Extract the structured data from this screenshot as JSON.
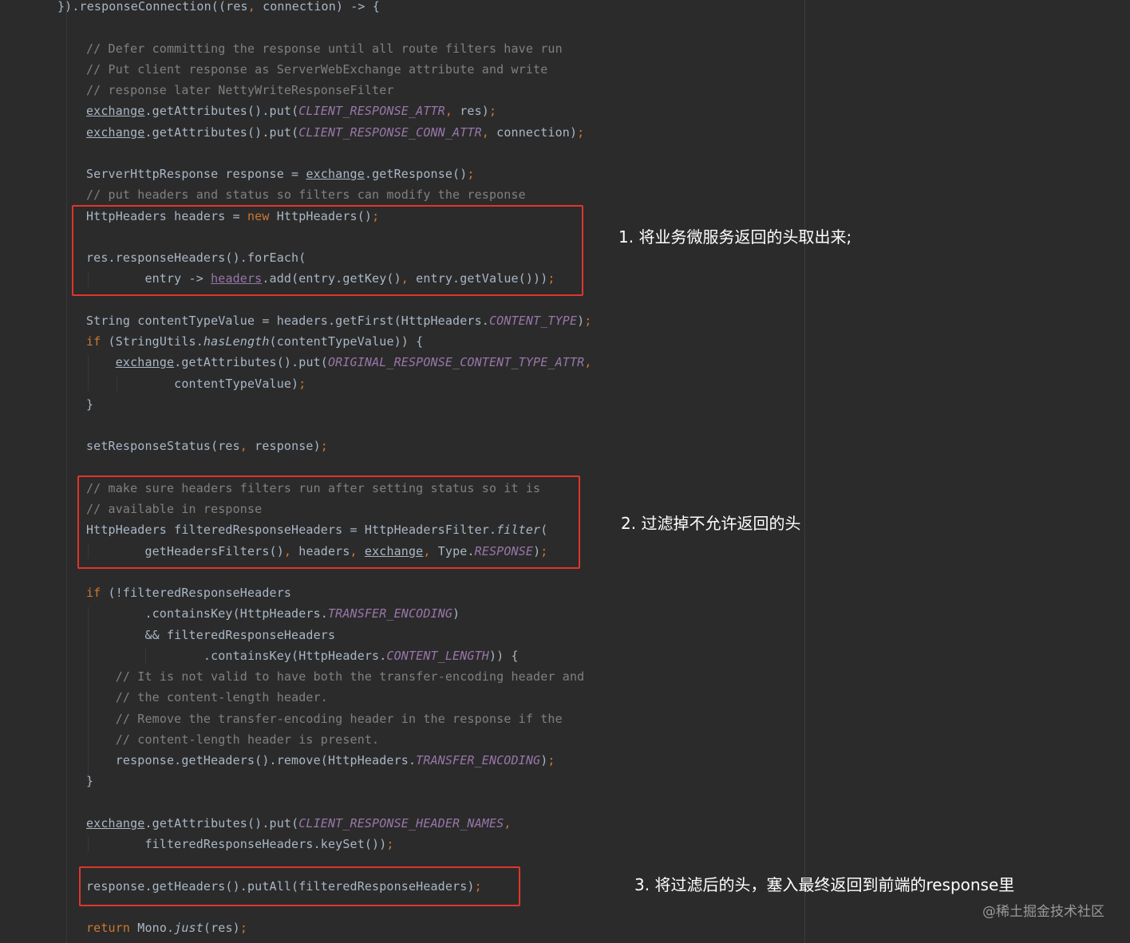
{
  "editor": {
    "lines": [
      [
        [
          "p",
          "}).responseConnection((res"
        ],
        [
          "pu",
          ","
        ],
        [
          "p",
          " connection) -> {"
        ]
      ],
      [],
      [
        [
          "cm",
          "// Defer committing the response until all route filters have run"
        ]
      ],
      [
        [
          "cm",
          "// Put client response as ServerWebExchange attribute and write"
        ]
      ],
      [
        [
          "cm",
          "// response later NettyWriteResponseFilter"
        ]
      ],
      [
        [
          "ul",
          "exchange"
        ],
        [
          "p",
          ".getAttributes().put("
        ],
        [
          "fd",
          "CLIENT_RESPONSE_ATTR"
        ],
        [
          "pu",
          ","
        ],
        [
          "p",
          " res)"
        ],
        [
          "pu",
          ";"
        ]
      ],
      [
        [
          "ul",
          "exchange"
        ],
        [
          "p",
          ".getAttributes().put("
        ],
        [
          "fd",
          "CLIENT_RESPONSE_CONN_ATTR"
        ],
        [
          "pu",
          ","
        ],
        [
          "p",
          " connection)"
        ],
        [
          "pu",
          ";"
        ]
      ],
      [],
      [
        [
          "p",
          "ServerHttpResponse response = "
        ],
        [
          "ul",
          "exchange"
        ],
        [
          "p",
          ".getResponse()"
        ],
        [
          "pu",
          ";"
        ]
      ],
      [
        [
          "cm",
          "// put headers and status so filters can modify the response"
        ]
      ],
      [
        [
          "p",
          "HttpHeaders headers = "
        ],
        [
          "kw",
          "new"
        ],
        [
          "p",
          " HttpHeaders()"
        ],
        [
          "pu",
          ";"
        ]
      ],
      [],
      [
        [
          "p",
          "res.responseHeaders().forEach("
        ]
      ],
      [
        [
          "p",
          "        entry -> "
        ],
        [
          "ulp",
          "headers"
        ],
        [
          "p",
          ".add(entry.getKey()"
        ],
        [
          "pu",
          ","
        ],
        [
          "p",
          " entry.getValue()))"
        ],
        [
          "pu",
          ";"
        ]
      ],
      [],
      [
        [
          "p",
          "String contentTypeValue = headers.getFirst(HttpHeaders."
        ],
        [
          "fd",
          "CONTENT_TYPE"
        ],
        [
          "p",
          ")"
        ],
        [
          "pu",
          ";"
        ]
      ],
      [
        [
          "kw",
          "if"
        ],
        [
          "p",
          " (StringUtils."
        ],
        [
          "mi",
          "hasLength"
        ],
        [
          "p",
          "(contentTypeValue)) {"
        ]
      ],
      [
        [
          "p",
          "    "
        ],
        [
          "ul",
          "exchange"
        ],
        [
          "p",
          ".getAttributes().put("
        ],
        [
          "fd",
          "ORIGINAL_RESPONSE_CONTENT_TYPE_ATTR"
        ],
        [
          "pu",
          ","
        ]
      ],
      [
        [
          "p",
          "            contentTypeValue)"
        ],
        [
          "pu",
          ";"
        ]
      ],
      [
        [
          "p",
          "}"
        ]
      ],
      [],
      [
        [
          "p",
          "setResponseStatus(res"
        ],
        [
          "pu",
          ","
        ],
        [
          "p",
          " response)"
        ],
        [
          "pu",
          ";"
        ]
      ],
      [],
      [
        [
          "cm",
          "// make sure headers filters run after setting status so it is"
        ]
      ],
      [
        [
          "cm",
          "// available in response"
        ]
      ],
      [
        [
          "p",
          "HttpHeaders filteredResponseHeaders = HttpHeadersFilter."
        ],
        [
          "mi",
          "filter"
        ],
        [
          "p",
          "("
        ]
      ],
      [
        [
          "p",
          "        getHeadersFilters()"
        ],
        [
          "pu",
          ","
        ],
        [
          "p",
          " headers"
        ],
        [
          "pu",
          ","
        ],
        [
          "p",
          " "
        ],
        [
          "ul",
          "exchange"
        ],
        [
          "pu",
          ","
        ],
        [
          "p",
          " Type."
        ],
        [
          "fd",
          "RESPONSE"
        ],
        [
          "p",
          ")"
        ],
        [
          "pu",
          ";"
        ]
      ],
      [],
      [
        [
          "kw",
          "if"
        ],
        [
          "p",
          " (!filteredResponseHeaders"
        ]
      ],
      [
        [
          "p",
          "        .containsKey(HttpHeaders."
        ],
        [
          "fd",
          "TRANSFER_ENCODING"
        ],
        [
          "p",
          ")"
        ]
      ],
      [
        [
          "p",
          "        && filteredResponseHeaders"
        ]
      ],
      [
        [
          "p",
          "                .containsKey(HttpHeaders."
        ],
        [
          "fd",
          "CONTENT_LENGTH"
        ],
        [
          "p",
          ")) {"
        ]
      ],
      [
        [
          "p",
          "    "
        ],
        [
          "cm",
          "// It is not valid to have both the transfer-encoding header and"
        ]
      ],
      [
        [
          "p",
          "    "
        ],
        [
          "cm",
          "// the content-length header."
        ]
      ],
      [
        [
          "p",
          "    "
        ],
        [
          "cm",
          "// Remove the transfer-encoding header in the response if the"
        ]
      ],
      [
        [
          "p",
          "    "
        ],
        [
          "cm",
          "// content-length header is present."
        ]
      ],
      [
        [
          "p",
          "    response.getHeaders().remove(HttpHeaders."
        ],
        [
          "fd",
          "TRANSFER_ENCODING"
        ],
        [
          "p",
          ")"
        ],
        [
          "pu",
          ";"
        ]
      ],
      [
        [
          "p",
          "}"
        ]
      ],
      [],
      [
        [
          "ul",
          "exchange"
        ],
        [
          "p",
          ".getAttributes().put("
        ],
        [
          "fd",
          "CLIENT_RESPONSE_HEADER_NAMES"
        ],
        [
          "pu",
          ","
        ]
      ],
      [
        [
          "p",
          "        filteredResponseHeaders.keySet())"
        ],
        [
          "pu",
          ";"
        ]
      ],
      [],
      [
        [
          "p",
          "response.getHeaders().putAll(filteredResponseHeaders)"
        ],
        [
          "pu",
          ";"
        ]
      ],
      [],
      [
        [
          "kw",
          "return"
        ],
        [
          "p",
          " Mono."
        ],
        [
          "mi",
          "just"
        ],
        [
          "p",
          "(res)"
        ],
        [
          "pu",
          ";"
        ]
      ]
    ]
  },
  "annotations": {
    "note1": "1. 将业务微服务返回的头取出来;",
    "note2": "2. 过滤掉不允许返回的头",
    "note3": "3. 将过滤后的头，塞入最终返回到前端的response里"
  },
  "watermark": "@稀土掘金技术社区",
  "colors": {
    "background": "#2b2b2b",
    "plain": "#a9b7c6",
    "comment": "#808080",
    "keyword": "#cc7832",
    "field": "#9876aa",
    "highlight_box": "#e0352b"
  }
}
